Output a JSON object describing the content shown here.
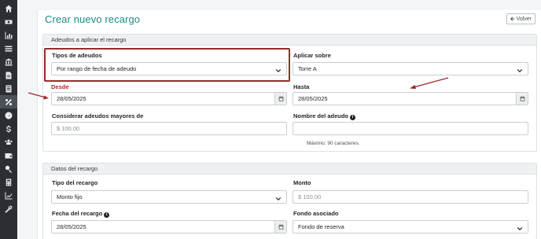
{
  "sidebar": {
    "items": [
      {
        "icon": "home-icon"
      },
      {
        "icon": "money-icon"
      },
      {
        "icon": "chart-icon"
      },
      {
        "icon": "list-icon"
      },
      {
        "icon": "bank-icon"
      },
      {
        "icon": "document-icon"
      },
      {
        "icon": "receipt-icon"
      },
      {
        "icon": "percent-icon",
        "active": true
      },
      {
        "icon": "gauge-icon"
      },
      {
        "icon": "dollar-icon"
      },
      {
        "icon": "users-icon"
      },
      {
        "icon": "wallet-icon"
      },
      {
        "icon": "key-icon"
      },
      {
        "icon": "calculator-icon"
      },
      {
        "icon": "line-chart-icon"
      },
      {
        "icon": "wrench-icon"
      }
    ]
  },
  "header": {
    "title": "Crear nuevo recargo",
    "back_label": "Volver"
  },
  "section1": {
    "title": "Adeudos a aplicar el recargo",
    "tipos_label": "Tipos de adeudos",
    "tipos_value": "Por rango de fecha de adeudo",
    "aplicar_label": "Aplicar sobre",
    "aplicar_value": "Torre A",
    "desde_label": "Desde",
    "desde_value": "28/05/2025",
    "hasta_label": "Hasta",
    "hasta_value": "28/05/2025",
    "mayores_label": "Considerar adeudos mayores de",
    "mayores_placeholder": "$ 100.00",
    "nombre_label": "Nombre del adeudo",
    "nombre_value": "",
    "nombre_hint": "Máximo: 90 caracteres."
  },
  "section2": {
    "title": "Datos del recargo",
    "tipo_label": "Tipo del recargo",
    "tipo_value": "Monto fijo",
    "monto_label": "Monto",
    "monto_placeholder": "$ 100.00",
    "fecha_label": "Fecha del recargo",
    "fecha_value": "28/05/2025",
    "fondo_label": "Fondo asociado",
    "fondo_value": "Fondo de reserva"
  },
  "colors": {
    "accent": "#1f8a8a",
    "highlight": "#9a2a2a",
    "sidebar": "#2b2f33"
  }
}
